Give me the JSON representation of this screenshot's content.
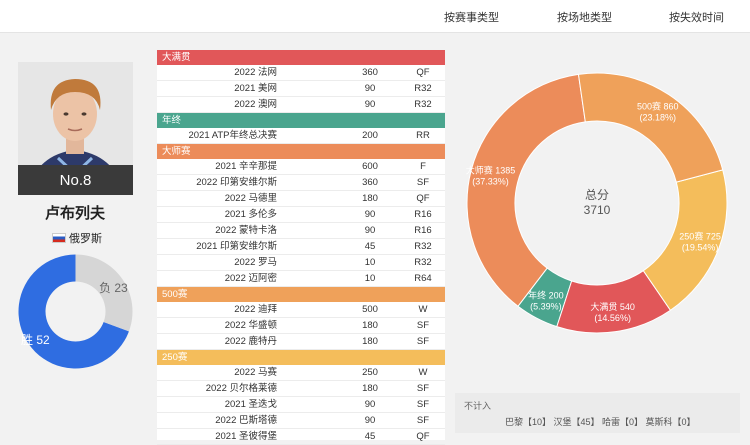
{
  "filters": {
    "tab1": "按赛事类型",
    "tab2": "按场地类型",
    "tab3": "按失效时间"
  },
  "player": {
    "rank_badge": "No.8",
    "name": "卢布列夫",
    "country": "俄罗斯",
    "wins_label": "胜 52",
    "losses_label": "负 23",
    "wins": 52,
    "losses": 23
  },
  "colors": {
    "grandslam": "#e15759",
    "finals": "#4aa58e",
    "masters": "#ec8c5a",
    "500": "#efa15a",
    "250": "#f4bd5b",
    "win": "#2f6de1",
    "loss": "#d6d6d6"
  },
  "sections": [
    {
      "title": "大满贯",
      "color_key": "grandslam",
      "rows": [
        {
          "event": "2022 法网",
          "points": "360",
          "round": "QF"
        },
        {
          "event": "2021 美网",
          "points": "90",
          "round": "R32"
        },
        {
          "event": "2022 澳网",
          "points": "90",
          "round": "R32"
        }
      ]
    },
    {
      "title": "年终",
      "color_key": "finals",
      "rows": [
        {
          "event": "2021 ATP年终总决赛",
          "points": "200",
          "round": "RR"
        }
      ]
    },
    {
      "title": "大师赛",
      "color_key": "masters",
      "rows": [
        {
          "event": "2021 辛辛那提",
          "points": "600",
          "round": "F"
        },
        {
          "event": "2022 印第安维尔斯",
          "points": "360",
          "round": "SF"
        },
        {
          "event": "2022 马德里",
          "points": "180",
          "round": "QF"
        },
        {
          "event": "2021 多伦多",
          "points": "90",
          "round": "R16"
        },
        {
          "event": "2022 蒙特卡洛",
          "points": "90",
          "round": "R16"
        },
        {
          "event": "2021 印第安维尔斯",
          "points": "45",
          "round": "R32"
        },
        {
          "event": "2022 罗马",
          "points": "10",
          "round": "R32"
        },
        {
          "event": "2022 迈阿密",
          "points": "10",
          "round": "R64"
        }
      ]
    },
    {
      "title": "500赛",
      "color_key": "500",
      "rows": [
        {
          "event": "2022 迪拜",
          "points": "500",
          "round": "W"
        },
        {
          "event": "2022 华盛顿",
          "points": "180",
          "round": "SF"
        },
        {
          "event": "2022 鹿特丹",
          "points": "180",
          "round": "SF"
        }
      ]
    },
    {
      "title": "250赛",
      "color_key": "250",
      "rows": [
        {
          "event": "2022 马赛",
          "points": "250",
          "round": "W"
        },
        {
          "event": "2022 贝尔格莱德",
          "points": "180",
          "round": "SF"
        },
        {
          "event": "2021 圣迭戈",
          "points": "90",
          "round": "SF"
        },
        {
          "event": "2022 巴斯塔德",
          "points": "90",
          "round": "SF"
        },
        {
          "event": "2021 圣彼得堡",
          "points": "45",
          "round": "QF"
        }
      ]
    }
  ],
  "chart_data": {
    "type": "pie",
    "center_label": "总分",
    "center_value": "3710",
    "slices": [
      {
        "name": "大满贯",
        "value": 540,
        "pct": "14.56%",
        "color": "#e15759"
      },
      {
        "name": "年终",
        "value": 200,
        "pct": "5.39%",
        "color": "#4aa58e"
      },
      {
        "name": "大师赛",
        "value": 1385,
        "pct": "37.33%",
        "color": "#ec8c5a"
      },
      {
        "name": "500赛",
        "value": 860,
        "pct": "23.18%",
        "color": "#efa15a"
      },
      {
        "name": "250赛",
        "value": 725,
        "pct": "19.54%",
        "color": "#f4bd5b"
      }
    ]
  },
  "not_counted": {
    "title": "不计入",
    "items": "巴黎【10】 汉堡【45】 哈雷【0】 莫斯科【0】"
  }
}
